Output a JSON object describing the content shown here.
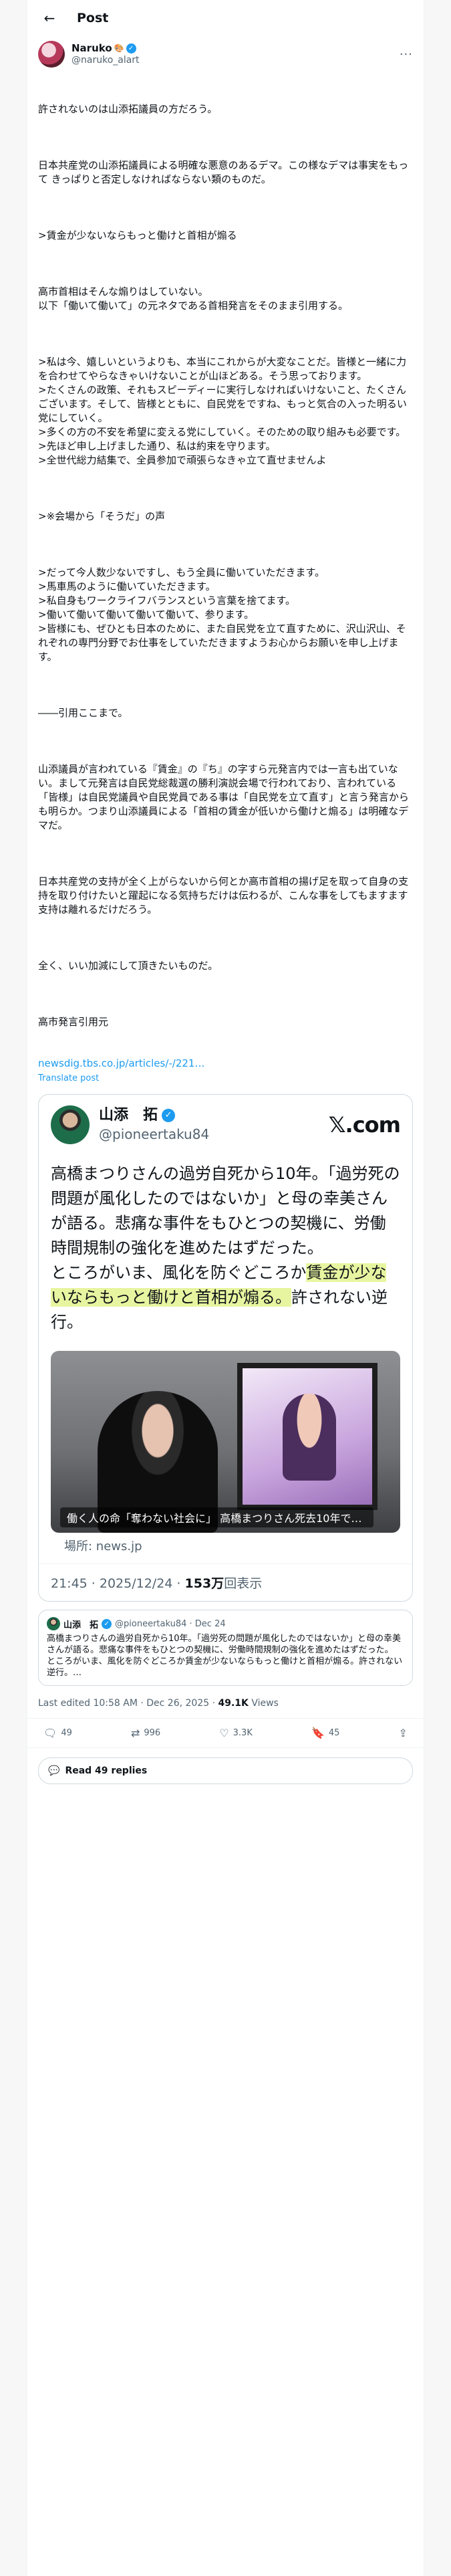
{
  "header": {
    "title": "Post"
  },
  "author": {
    "name": "Naruko",
    "emoji": "🎨",
    "handle": "@naruko_alart"
  },
  "post": {
    "paragraphs": [
      "許されないのは山添拓議員の方だろう。",
      "日本共産党の山添拓議員による明確な悪意のあるデマ。この様なデマは事実をもって きっぱりと否定しなければならない類のものだ。",
      ">賃金が少ないならもっと働けと首相が煽る",
      "高市首相はそんな煽りはしていない。\n以下「働いて働いて」の元ネタである首相発言をそのまま引用する。",
      ">私は今、嬉しいというよりも、本当にこれからが大変なことだ。皆様と一緒に力を合わせてやらなきゃいけないことが山ほどある。そう思っております。\n>たくさんの政策、それもスピーディーに実行しなければいけないこと、たくさんございます。そして、皆様とともに、自民党をですね、もっと気合の入った明るい党にしていく。\n>多くの方の不安を希望に変える党にしていく。そのための取り組みも必要です。\n>先ほど申し上げました通り、私は約束を守ります。\n>全世代総力結集で、全員参加で頑張らなきゃ立て直せませんよ",
      ">※会場から「そうだ」の声",
      ">だって今人数少ないですし、もう全員に働いていただきます。\n>馬車馬のように働いていただきます。\n>私自身もワークライフバランスという言葉を捨てます。\n>働いて働いて働いて働いて働いて、参ります。\n>皆様にも、ぜひとも日本のために、また自民党を立て直すために、沢山沢山、それぞれの専門分野でお仕事をしていただきますようお心からお願いを申し上げます。",
      "――引用ここまで。",
      "山添議員が言われている『賃金』の『ち』の字すら元発言内では一言も出ていない。まして元発言は自民党総裁選の勝利演説会場で行われており、言われている「皆様」は自民党議員や自民党員である事は「自民党を立て直す」と言う発言からも明らか。つまり山添議員による「首相の賃金が低いから働けと煽る」は明確なデマだ。",
      "日本共産党の支持が全く上がらないから何とか高市首相の揚げ足を取って自身の支持を取り付けたいと躍起になる気持ちだけは伝わるが、こんな事をしてもますます支持は離れるだけだろう。",
      "全く、いい加減にして頂きたいものだ。",
      "高市発言引用元"
    ],
    "link": "newsdig.tbs.co.jp/articles/-/221…",
    "translate": "Translate post"
  },
  "card": {
    "name": "山添　拓",
    "handle": "@pioneertaku84",
    "brand": "𝕏.com",
    "text_plain": "高橋まつりさんの過労自死から10年。「過労死の問題が風化したのではないか」と母の幸美さんが語る。悲痛な事件をもひとつの契機に、労働時間規制の強化を進めたはずだった。\nところがいま、風化を防ぐどころか",
    "text_highlight": "賃金が少ないならもっと働けと首相が煽る。",
    "text_tail": "許されない逆行。",
    "image_caption": "働く人の命「奪わない社会に」 高橋まつりさん死去10年で母 i…",
    "location": "場所: news.jp",
    "time": "21:45 · 2025/12/24 · ",
    "views_count": "153万",
    "views_label": "回表示"
  },
  "quote": {
    "name": "山添　拓",
    "meta": "@pioneertaku84 · Dec 24",
    "text": "高橋まつりさんの過労自死から10年。「過労死の問題が風化したのではないか」と母の幸美さんが語る。悲痛な事件をもひとつの契機に、労働時間規制の強化を進めたはずだった。\nところがいま、風化を防ぐどころか賃金が少ないならもっと働けと首相が煽る。許されない逆行。…"
  },
  "meta": {
    "edited": "Last edited 10:58 AM · Dec 26, 2025 · ",
    "views": "49.1K",
    "views_label": " Views"
  },
  "actions": {
    "replies": "49",
    "reposts": "996",
    "likes": "3.3K",
    "bookmarks": "45"
  },
  "read_replies": "Read 49 replies"
}
